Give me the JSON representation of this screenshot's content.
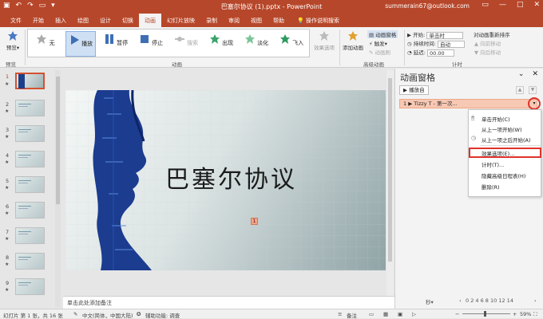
{
  "titlebar": {
    "title": "巴塞尔协议 (1).pptx - PowerPoint",
    "user": "summerain67@outlook.com",
    "quick_access": [
      "save-icon",
      "undo-icon",
      "redo-icon",
      "start-icon",
      "more-icon"
    ],
    "window_buttons": [
      "—",
      "□",
      "✕"
    ]
  },
  "tabs": [
    "文件",
    "开始",
    "插入",
    "绘图",
    "设计",
    "切换",
    "动画",
    "幻灯片放映",
    "录制",
    "审阅",
    "视图",
    "帮助",
    "操作说明搜索"
  ],
  "active_tab": "动画",
  "ribbon": {
    "preview": {
      "label": "预览",
      "group": "预览"
    },
    "effects": [
      {
        "label": "无"
      },
      {
        "label": "播放"
      },
      {
        "label": "暂停"
      },
      {
        "label": "停止"
      },
      {
        "label": "搜索"
      },
      {
        "label": "出现"
      },
      {
        "label": "淡化"
      },
      {
        "label": "飞入"
      }
    ],
    "effect_options": "效果选项",
    "animation_group": "动画",
    "add_animation": "添加动画",
    "anim_pane_btn": "动画窗格",
    "trigger": "触发",
    "anim_painter": "动画刷",
    "advanced_group": "高级动画",
    "start_label": "开始:",
    "start_value": "单击时",
    "duration_label": "持续时间:",
    "duration_value": "自动",
    "delay_label": "延迟:",
    "delay_value": "00.00",
    "reorder_title": "对动画重新排序",
    "move_earlier": "向前移动",
    "move_later": "向后移动",
    "timing_group": "计时"
  },
  "slides": [
    {
      "num": "1"
    },
    {
      "num": "2"
    },
    {
      "num": "3"
    },
    {
      "num": "4"
    },
    {
      "num": "5"
    },
    {
      "num": "6"
    },
    {
      "num": "7"
    },
    {
      "num": "8"
    },
    {
      "num": "9"
    }
  ],
  "slide": {
    "title": "巴塞尔协议",
    "anim_tag": "1"
  },
  "notes_placeholder": "单击此处添加备注",
  "pane": {
    "title": "动画窗格",
    "play_from": "播放自",
    "item": "1  ▶ Tizzy T - 第一次...",
    "menu": [
      "单击开始(C)",
      "从上一项开始(W)",
      "从上一项之后开始(A)",
      "效果选项(E)...",
      "计时(T)...",
      "隐藏高级日程表(H)",
      "删除(R)"
    ],
    "footer_unit": "秒",
    "footer_ticks": "0  2  4  6  8  10  12  14"
  },
  "status": {
    "slide_info": "幻灯片 第 1 张，共 16 张",
    "language": "中文(简体，中国大陆)",
    "accessibility": "辅助功能: 调查",
    "notes": "备注",
    "zoom": "59%"
  },
  "colors": {
    "accent": "#b7472a",
    "highlight": "#e0312c"
  }
}
